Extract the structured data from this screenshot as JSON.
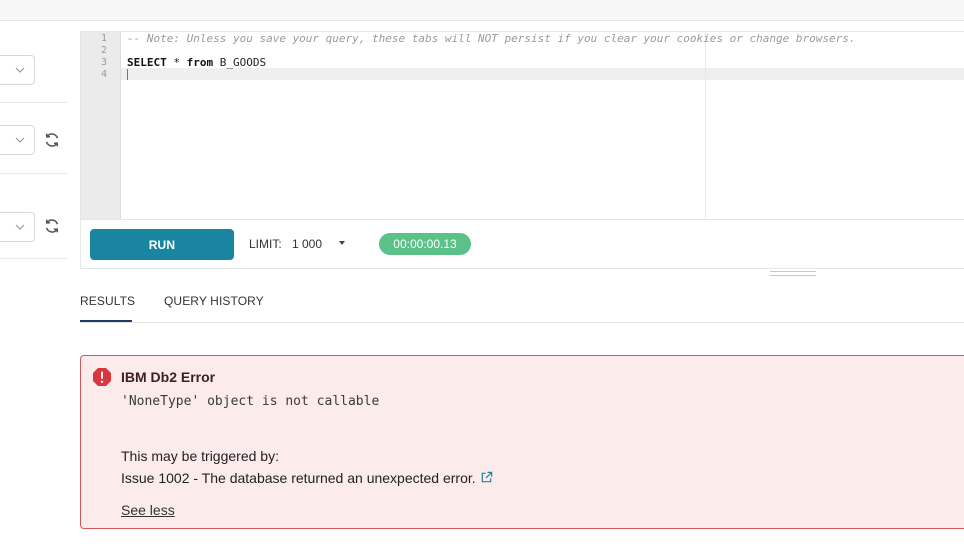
{
  "editor": {
    "line_numbers": [
      "1",
      "2",
      "3",
      "4"
    ],
    "lines": {
      "comment": "-- Note: Unless you save your query, these tabs will NOT persist if you clear your cookies or change browsers.",
      "empty": "",
      "select_kw": "SELECT",
      "star": " * ",
      "from_kw": "from",
      "table": " B_GOODS"
    }
  },
  "toolbar": {
    "run_label": "RUN",
    "limit_label": "LIMIT:",
    "limit_value": "1 000",
    "elapsed": "00:00:00.13"
  },
  "tabs": [
    {
      "label": "RESULTS",
      "active": true
    },
    {
      "label": "QUERY HISTORY",
      "active": false
    }
  ],
  "error": {
    "title": "IBM Db2 Error",
    "message": "'NoneType' object is not callable",
    "trigger_text": "This may be triggered by:",
    "issue_text": "Issue 1002 - The database returned an unexpected error.",
    "see_less_label": "See less"
  },
  "colors": {
    "run_button": "#1a85a0",
    "timer_badge": "#5ac189",
    "error_border": "#d05858",
    "error_background": "#fbebeb",
    "error_icon": "#d9363e"
  },
  "icons": {
    "refresh": "refresh-icon",
    "chevron": "chevron-down-icon",
    "error": "error-icon",
    "external_link": "external-link-icon"
  }
}
